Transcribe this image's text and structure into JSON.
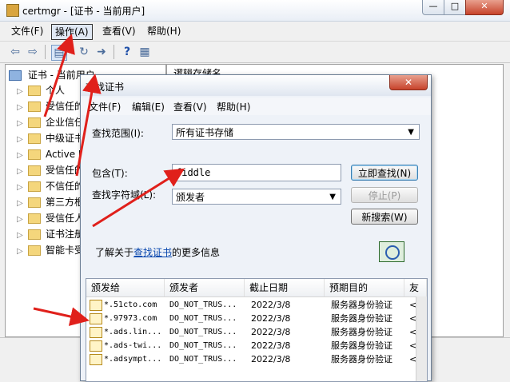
{
  "main": {
    "title": "certmgr - [证书 - 当前用户]",
    "window_buttons": {
      "minimize": "—",
      "maximize": "□",
      "close": "✕"
    },
    "menu": [
      "文件(F)",
      "操作(A)",
      "查看(V)",
      "帮助(H)"
    ],
    "toolbar_icons": [
      "back-icon",
      "forward-icon",
      "console-tree-icon",
      "refresh-icon",
      "export-icon",
      "help-icon",
      "properties-icon"
    ],
    "tree_root": "证书 - 当前用户",
    "tree_items": [
      "个人",
      "受信任的",
      "企业信任",
      "中级证书",
      "Active D",
      "受信任的",
      "不信任的",
      "第三方根",
      "受信任人",
      "证书注册",
      "智能卡受"
    ],
    "right_header": "逻辑存储名"
  },
  "dialog": {
    "title": "查找证书",
    "close_label": "✕",
    "menu": [
      "文件(F)",
      "编辑(E)",
      "查看(V)",
      "帮助(H)"
    ],
    "scope_label": "查找范围(I):",
    "scope_value": "所有证书存储",
    "contains_label": "包含(T):",
    "contains_value": "fiddle",
    "field_label": "查找字符域(L):",
    "field_value": "颁发者",
    "find_now": "立即查找(N)",
    "stop": "停止(P)",
    "new_search": "新搜索(W)",
    "learn_prefix": "了解关于",
    "learn_link": "查找证书",
    "learn_suffix": "的更多信息",
    "columns": [
      "颁发给",
      "颁发者",
      "截止日期",
      "预期目的",
      "友"
    ],
    "rows": [
      {
        "issued_to": "*.51cto.com",
        "issuer": "DO_NOT_TRUS...",
        "expires": "2022/3/8",
        "purpose": "服务器身份验证",
        "friendly": "<"
      },
      {
        "issued_to": "*.97973.com",
        "issuer": "DO_NOT_TRUS...",
        "expires": "2022/3/8",
        "purpose": "服务器身份验证",
        "friendly": "<"
      },
      {
        "issued_to": "*.ads.lin...",
        "issuer": "DO_NOT_TRUS...",
        "expires": "2022/3/8",
        "purpose": "服务器身份验证",
        "friendly": "<"
      },
      {
        "issued_to": "*.ads-twi...",
        "issuer": "DO_NOT_TRUS...",
        "expires": "2022/3/8",
        "purpose": "服务器身份验证",
        "friendly": "<"
      },
      {
        "issued_to": "*.adsympt...",
        "issuer": "DO_NOT_TRUS...",
        "expires": "2022/3/8",
        "purpose": "服务器身份验证",
        "friendly": "<"
      }
    ]
  },
  "colors": {
    "annotation_arrow": "#e0201b",
    "link": "#0645ad"
  }
}
